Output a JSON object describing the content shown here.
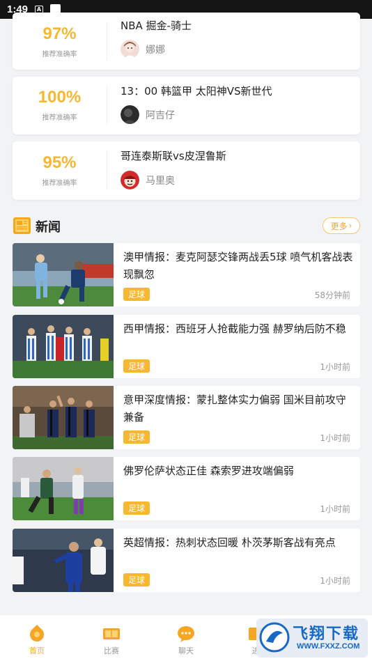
{
  "status_bar": {
    "time": "1:49",
    "icon_a": "A"
  },
  "recommendations": [
    {
      "percent": "97%",
      "percent_label": "推荐准确率",
      "title": "NBA 掘金-骑士",
      "author": "娜娜",
      "avatar_icon": "girl-avatar"
    },
    {
      "percent": "100%",
      "percent_label": "推荐准确率",
      "title": "13：00 韩篮甲 太阳神VS新世代",
      "author": "阿吉仔",
      "avatar_icon": "dark-avatar"
    },
    {
      "percent": "95%",
      "percent_label": "推荐准确率",
      "title": "哥连泰斯联vs皮涅鲁斯",
      "author": "马里奥",
      "avatar_icon": "mario-avatar"
    }
  ],
  "news": {
    "title": "新闻",
    "more_label": "更多",
    "items": [
      {
        "title": "澳甲情报：麦克阿瑟交锋两战丢5球 喷气机客战表现飘忽",
        "tag": "足球",
        "time": "58分钟前"
      },
      {
        "title": "西甲情报：西班牙人抢截能力强 赫罗纳后防不稳",
        "tag": "足球",
        "time": "1小时前"
      },
      {
        "title": "意甲深度情报：蒙扎整体实力偏弱 国米目前攻守兼备",
        "tag": "足球",
        "time": "1小时前"
      },
      {
        "title": "佛罗伦萨状态正佳 森索罗进攻端偏弱",
        "tag": "足球",
        "time": "1小时前"
      },
      {
        "title": "英超情报：热刺状态回暖 朴茨茅斯客战有亮点",
        "tag": "足球",
        "time": "1小时前"
      }
    ]
  },
  "bottom_nav": [
    {
      "label": "首页",
      "icon": "home-icon",
      "active": true
    },
    {
      "label": "比赛",
      "icon": "match-icon",
      "active": false
    },
    {
      "label": "聊天",
      "icon": "chat-icon",
      "active": false
    },
    {
      "label": "进",
      "icon": "more-icon",
      "active": false
    }
  ],
  "watermark": {
    "text": "飞翔下载",
    "url": "WWW.FXXZ.COM"
  },
  "colors": {
    "accent": "#f7b731",
    "accent_text": "#f0a93b",
    "background": "#f2f3f5"
  }
}
